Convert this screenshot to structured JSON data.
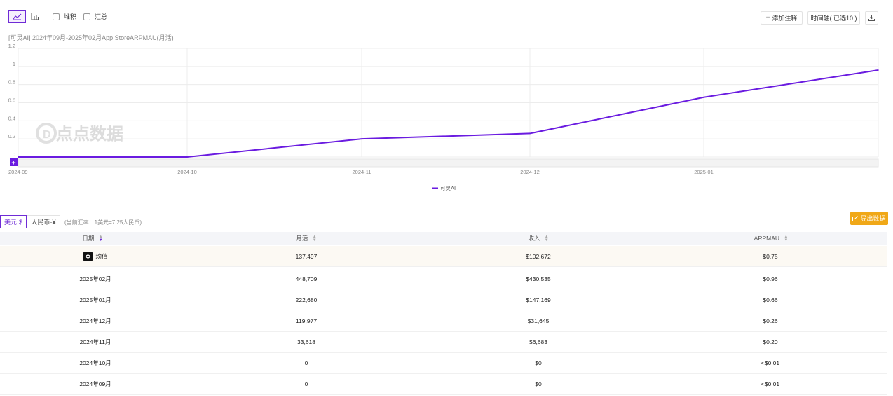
{
  "toolbar": {
    "stack_label": "堆积",
    "sum_label": "汇总",
    "add_annotation_label": "添加注释",
    "timeline_label": "时间轴( 已选10 )"
  },
  "chart_title": "[可灵AI] 2024年09月-2025年02月App StoreARPMAU(月活)",
  "watermark": "点点数据",
  "chart_data": {
    "type": "line",
    "x": [
      "2024-09",
      "2024-10",
      "2024-11",
      "2024-12",
      "2025-01",
      "2025-02"
    ],
    "x_tick_labels": [
      "2024-09",
      "2024-10",
      "2024-11",
      "2024-12",
      "2025-01"
    ],
    "y_tick_labels": [
      "1.2",
      "1",
      "0.8",
      "0.6",
      "0.4",
      "0.2",
      "0"
    ],
    "ylim": [
      0,
      1.2
    ],
    "series": [
      {
        "name": "可灵AI",
        "values": [
          0.0,
          0.0,
          0.2,
          0.26,
          0.66,
          0.96
        ],
        "color": "#6a1be0"
      }
    ],
    "legend_position": "bottom-center",
    "grid": true
  },
  "currency": {
    "usd_label": "美元·$",
    "cny_label": "人民币·¥",
    "rate_note": "(当前汇率：1美元=7.25人民币)"
  },
  "export_label": "导出数据",
  "table": {
    "headers": {
      "date": "日期",
      "mau": "月活",
      "revenue": "收入",
      "arpmau": "ARPMAU"
    },
    "avg_row": {
      "date": "均值",
      "mau": "137,497",
      "revenue": "$102,672",
      "arpmau": "$0.75"
    },
    "rows": [
      {
        "date": "2025年02月",
        "mau": "448,709",
        "revenue": "$430,535",
        "arpmau": "$0.96"
      },
      {
        "date": "2025年01月",
        "mau": "222,680",
        "revenue": "$147,169",
        "arpmau": "$0.66"
      },
      {
        "date": "2024年12月",
        "mau": "119,977",
        "revenue": "$31,645",
        "arpmau": "$0.26"
      },
      {
        "date": "2024年11月",
        "mau": "33,618",
        "revenue": "$6,683",
        "arpmau": "$0.20"
      },
      {
        "date": "2024年10月",
        "mau": "0",
        "revenue": "$0",
        "arpmau": "<$0.01"
      },
      {
        "date": "2024年09月",
        "mau": "0",
        "revenue": "$0",
        "arpmau": "<$0.01"
      }
    ]
  },
  "colors": {
    "accent": "#6f2bd6",
    "line": "#6a1be0",
    "export": "#f0a818"
  }
}
